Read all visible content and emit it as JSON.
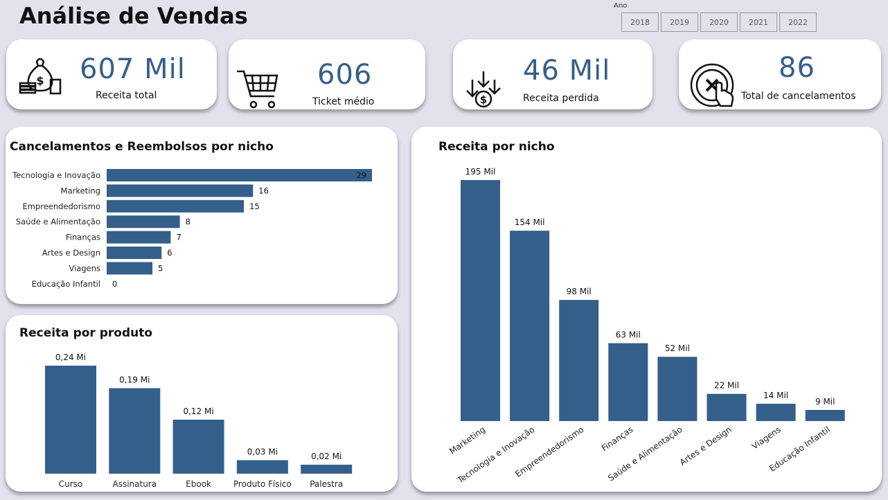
{
  "page": {
    "title": "Análise de Vendas"
  },
  "filter": {
    "label": "Ano",
    "years": [
      "2018",
      "2019",
      "2020",
      "2021",
      "2022"
    ]
  },
  "kpis": {
    "receita_total": {
      "value": "607 Mil",
      "label": "Receita total",
      "icon": "money-bag-icon"
    },
    "ticket_medio": {
      "value": "606",
      "label": "Ticket médio",
      "icon": "shopping-cart-icon"
    },
    "receita_perdida": {
      "value": "46 Mil",
      "label": "Receita perdida",
      "icon": "money-down-arrows-icon"
    },
    "total_cancelamentos": {
      "value": "86",
      "label": "Total de cancelamentos",
      "icon": "cancel-click-icon"
    }
  },
  "colors": {
    "bar": "#355f8b",
    "kpi_value": "#355f8b",
    "background": "#e2e1ec"
  },
  "chart_data": [
    {
      "id": "cancelamentos",
      "type": "bar",
      "orientation": "horizontal",
      "title": "Cancelamentos e Reembolsos por nicho",
      "categories": [
        "Tecnologia e Inovação",
        "Marketing",
        "Empreendedorismo",
        "Saúde e Alimentação",
        "Finanças",
        "Artes e Design",
        "Viagens",
        "Educação Infantil"
      ],
      "values": [
        29,
        16,
        15,
        8,
        7,
        6,
        5,
        0
      ],
      "labels": [
        "29",
        "16",
        "15",
        "8",
        "7",
        "6",
        "5",
        "0"
      ],
      "xlim": [
        0,
        29
      ]
    },
    {
      "id": "receita-produto",
      "type": "bar",
      "title": "Receita por produto",
      "categories": [
        "Curso",
        "Assinatura",
        "Ebook",
        "Produto Físico",
        "Palestra"
      ],
      "values": [
        0.24,
        0.19,
        0.12,
        0.03,
        0.02
      ],
      "labels": [
        "0,24 Mi",
        "0,19 Mi",
        "0,12 Mi",
        "0,03 Mi",
        "0,02 Mi"
      ],
      "ylim": [
        0,
        0.24
      ]
    },
    {
      "id": "receita-nicho",
      "type": "bar",
      "title": "Receita por nicho",
      "categories": [
        "Marketing",
        "Tecnologia e Inovação",
        "Empreendedorismo",
        "Finanças",
        "Saúde e Alimentação",
        "Artes e Design",
        "Viagens",
        "Educação Infantil"
      ],
      "values": [
        195,
        154,
        98,
        63,
        52,
        22,
        14,
        9
      ],
      "labels": [
        "195 Mil",
        "154 Mil",
        "98 Mil",
        "63 Mil",
        "52 Mil",
        "22 Mil",
        "14 Mil",
        "9 Mil"
      ],
      "ylim": [
        0,
        195
      ]
    }
  ]
}
